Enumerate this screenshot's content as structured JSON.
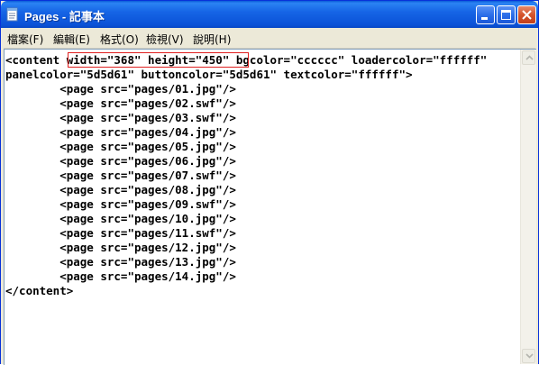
{
  "window": {
    "title": "Pages - 記事本",
    "accent_color": "#0a5bd8"
  },
  "title_buttons": {
    "minimize_icon": "minimize-icon",
    "maximize_icon": "maximize-icon",
    "close_icon": "close-icon"
  },
  "menu": {
    "items": [
      {
        "label": "檔案(F)"
      },
      {
        "label": "編輯(E)"
      },
      {
        "label": "格式(O)"
      },
      {
        "label": "檢視(V)"
      },
      {
        "label": "說明(H)"
      }
    ]
  },
  "editor": {
    "lines": [
      "<content width=\"368\" height=\"450\" bgcolor=\"cccccc\" loadercolor=\"ffffff\"",
      "panelcolor=\"5d5d61\" buttoncolor=\"5d5d61\" textcolor=\"ffffff\">",
      "        <page src=\"pages/01.jpg\"/>",
      "        <page src=\"pages/02.swf\"/>",
      "        <page src=\"pages/03.swf\"/>",
      "        <page src=\"pages/04.jpg\"/>",
      "        <page src=\"pages/05.jpg\"/>",
      "        <page src=\"pages/06.jpg\"/>",
      "        <page src=\"pages/07.swf\"/>",
      "        <page src=\"pages/08.jpg\"/>",
      "        <page src=\"pages/09.swf\"/>",
      "        <page src=\"pages/10.jpg\"/>",
      "        <page src=\"pages/11.swf\"/>",
      "        <page src=\"pages/12.jpg\"/>",
      "        <page src=\"pages/13.jpg\"/>",
      "        <page src=\"pages/14.jpg\"/>",
      "</content>"
    ],
    "highlight_color": "#e02020"
  }
}
